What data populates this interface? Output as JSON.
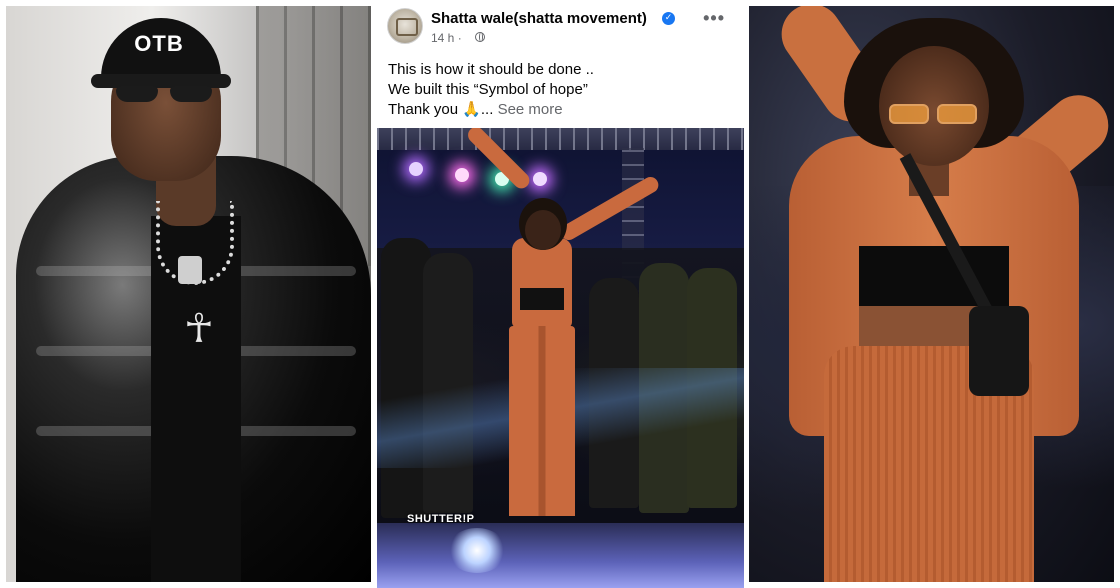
{
  "post": {
    "author": "Shatta wale(shatta movement)",
    "time": "14 h ·",
    "more_label": "•••",
    "verified_glyph": "✓",
    "caption_lines": [
      "This is how it should be done ..",
      "We built this “Symbol of hope”",
      "Thank you 🙏..."
    ],
    "see_more": "See more",
    "watermark": "SHUTTER!P"
  },
  "left_photo": {
    "cap_text": "OTB",
    "pendant_glyph": "☥"
  },
  "icons": {
    "avatar": "page-avatar",
    "verified": "verified-badge-icon",
    "globe": "globe-icon",
    "more": "more-options-icon"
  },
  "colors": {
    "verified": "#1877f2",
    "text": "#050505",
    "muted": "#65676b"
  }
}
